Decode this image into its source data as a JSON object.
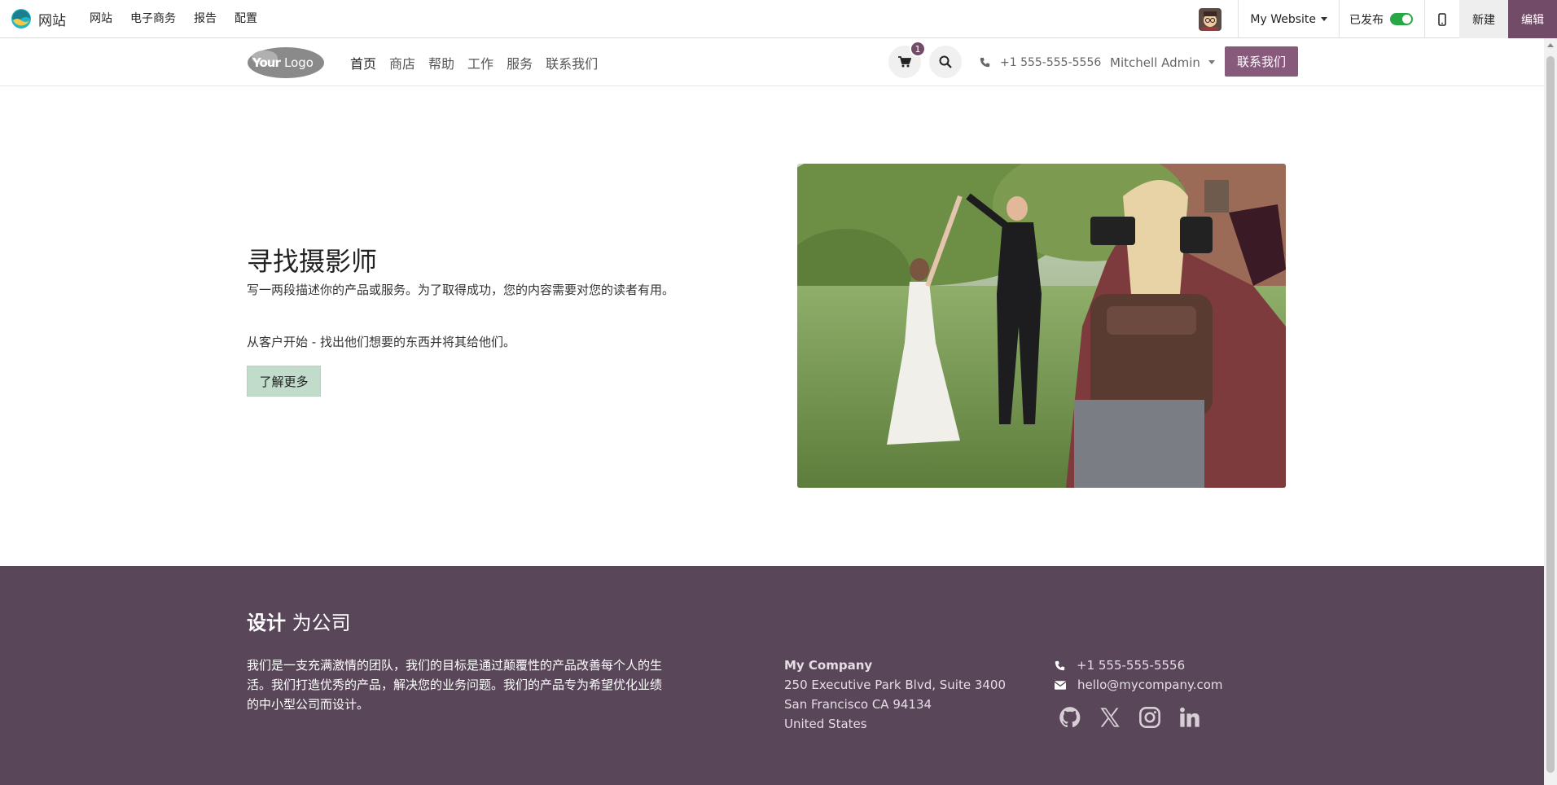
{
  "adminbar": {
    "app_name": "网站",
    "menu": [
      {
        "label": "网站"
      },
      {
        "label": "电子商务"
      },
      {
        "label": "报告"
      },
      {
        "label": "配置"
      }
    ],
    "website_selector": "My Website",
    "published_label": "已发布",
    "new_label": "新建",
    "edit_label": "编辑"
  },
  "header": {
    "nav": [
      {
        "label": "首页",
        "active": true
      },
      {
        "label": "商店"
      },
      {
        "label": "帮助"
      },
      {
        "label": "工作"
      },
      {
        "label": "服务"
      },
      {
        "label": "联系我们"
      }
    ],
    "cart_count": "1",
    "phone": "+1 555-555-5556",
    "user": "Mitchell Admin",
    "contact_button": "联系我们"
  },
  "hero": {
    "title": "寻找摄影师",
    "paragraph1": "写一两段描述你的产品或服务。为了取得成功，您的内容需要对您的读者有用。",
    "paragraph2": "从客户开始 - 找出他们想要的东西并将其给他们。",
    "button": "了解更多"
  },
  "footer": {
    "title_bold": "设计",
    "title_rest": "为公司",
    "description": "我们是一支充满激情的团队，我们的目标是通过颠覆性的产品改善每个人的生活。我们打造优秀的产品，解决您的业务问题。我们的产品专为希望优化业绩的中小型公司而设计。",
    "company_name": "My Company",
    "address_line1": "250 Executive Park Blvd, Suite 3400",
    "address_line2": "San Francisco CA 94134",
    "address_line3": "United States",
    "phone": "+1 555-555-5556",
    "email": "hello@mycompany.com",
    "social": [
      "github-icon",
      "x-icon",
      "instagram-icon",
      "linkedin-icon"
    ]
  },
  "colors": {
    "brand": "#714b67",
    "footer_bg": "#594759",
    "contact_button": "#875a7b",
    "hero_button": "#c2dccb",
    "published_toggle": "#28a745"
  }
}
